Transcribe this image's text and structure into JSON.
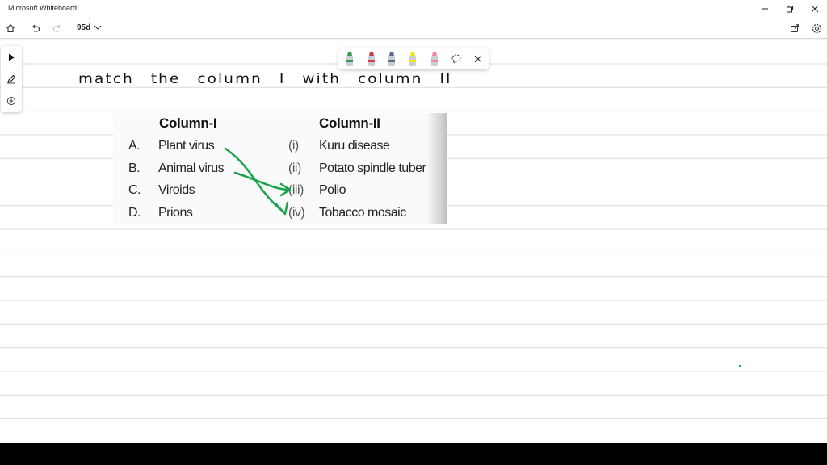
{
  "window": {
    "title": "Microsoft Whiteboard",
    "controls": [
      "minimize-icon",
      "restore-icon",
      "close-icon"
    ]
  },
  "toolbar": {
    "board_name": "95d",
    "icons": [
      "home-icon",
      "undo-icon",
      "redo-icon",
      "chevron-down-icon",
      "share-icon",
      "settings-icon"
    ]
  },
  "left_tools": [
    "select-arrow-icon",
    "pen-icon",
    "add-icon"
  ],
  "pen_tray": {
    "pens": [
      {
        "name": "green-pen",
        "color": "#2e9e4f"
      },
      {
        "name": "red-pen",
        "color": "#d23b3b"
      },
      {
        "name": "blue-pen",
        "color": "#5a6b8c"
      },
      {
        "name": "yellow-highlighter",
        "color": "#f2e21a"
      },
      {
        "name": "pink-eraser",
        "color": "#f08a9a"
      }
    ],
    "icons": [
      "lasso-icon",
      "close-icon"
    ]
  },
  "canvas": {
    "handwriting": "match the column I with column II",
    "ink_color": "#1aa34a"
  },
  "table": {
    "col1_header": "Column-I",
    "col2_header": "Column-II",
    "rows": [
      {
        "letter": "A.",
        "item": "Plant virus",
        "num": "(i)",
        "match": "Kuru disease"
      },
      {
        "letter": "B.",
        "item": "Animal virus",
        "num": "(ii)",
        "match": "Potato spindle tuber"
      },
      {
        "letter": "C.",
        "item": "Viroids",
        "num": "(iii)",
        "match": "Polio"
      },
      {
        "letter": "D.",
        "item": "Prions",
        "num": "(iv)",
        "match": "Tobacco mosaic"
      }
    ]
  }
}
